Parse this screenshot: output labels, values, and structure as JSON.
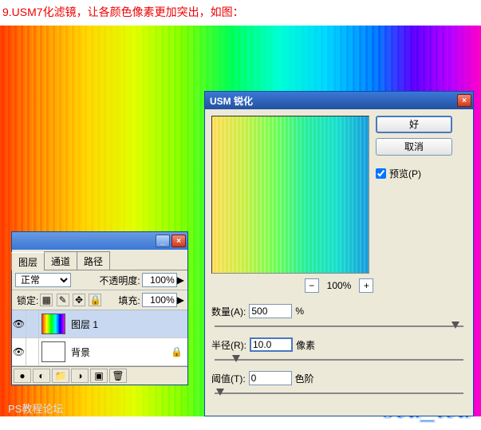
{
  "caption": "9.USM7化滤镜，让各颜色像素更加突出，如图：",
  "watermark": "sea_tea",
  "website_line1": "PS教程论坛",
  "website_line2": "",
  "layers_panel": {
    "tabs": [
      "图层",
      "通道",
      "路径"
    ],
    "blend_label": "正常",
    "opacity_label": "不透明度:",
    "opacity_value": "100%",
    "lock_label": "锁定:",
    "fill_label": "填充:",
    "fill_value": "100%",
    "layers": [
      {
        "name": "图层 1"
      },
      {
        "name": "背景"
      }
    ]
  },
  "usm_dialog": {
    "title": "USM 锐化",
    "ok": "好",
    "cancel": "取消",
    "preview": "预览(P)",
    "zoom": "100%",
    "amount_label": "数量(A):",
    "amount_value": "500",
    "amount_unit": "%",
    "radius_label": "半径(R):",
    "radius_value": "10.0",
    "radius_unit": "像素",
    "threshold_label": "阈值(T):",
    "threshold_value": "0",
    "threshold_unit": "色阶"
  }
}
